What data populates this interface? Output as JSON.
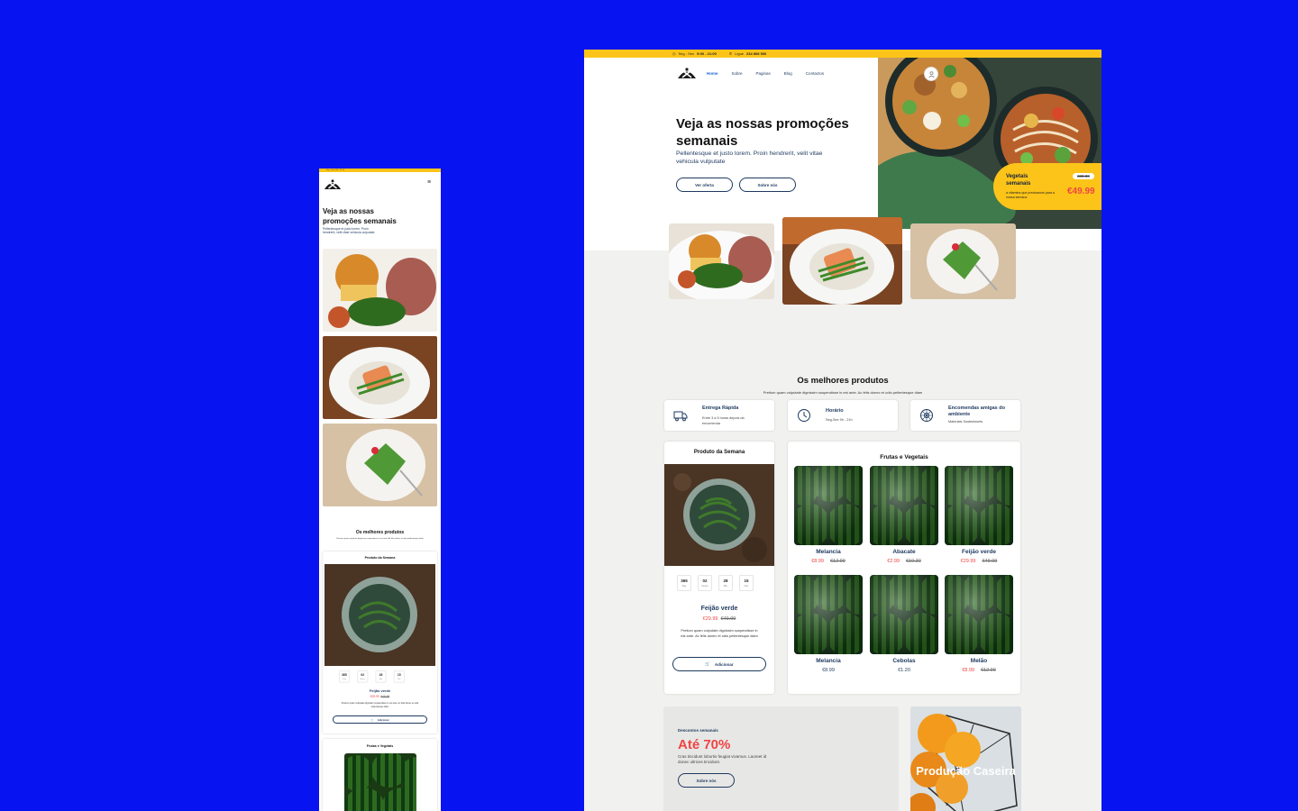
{
  "colors": {
    "background": "#0713f0",
    "accent_yellow": "#fcc419",
    "price_red": "#ef4444",
    "navy": "#1e3a5f"
  },
  "topbar": {
    "hours_label": "Seg - Sex",
    "hours_value": "9:00 - 21:00",
    "phone_label": "Ligue",
    "phone_value": "234 808 500"
  },
  "mobile_topbar": {
    "text": "Seg - Sex  9:00 - 21:00"
  },
  "nav": {
    "items": [
      {
        "label": "Home"
      },
      {
        "label": "Sobre"
      },
      {
        "label": "Paginas"
      },
      {
        "label": "Blog"
      },
      {
        "label": "Contactos"
      }
    ]
  },
  "hero": {
    "title": "Veja as nossas promoções semanais",
    "subtitle": "Pellentesque et justo lorem. Proin hendrerit, velit vitae vehicula vulputate",
    "primary_button": "Ver oferta",
    "secondary_button": "Sobre nós"
  },
  "promo": {
    "title": "Vegetais semanais",
    "description": "a vitamina que precisamos para a nossa semana",
    "old_price": "€80.00",
    "new_price": "€49.99"
  },
  "section": {
    "title": "Os melhores produtos",
    "subtitle": "Pretium quam vulputate dignissim suspendisse in est ante. Ac felis donec et odio pellentesque diam"
  },
  "features": [
    {
      "title": "Entrega Rápida",
      "desc": "Entre 3 a 5 horas depois da encomenda",
      "icon": "truck-icon"
    },
    {
      "title": "Horário",
      "desc": "Seg-Sex 9h - 21h",
      "icon": "clock-icon"
    },
    {
      "title": "Encomendas amigas do ambiente",
      "desc": "Materiais Sustentaveis",
      "icon": "eco-icon"
    }
  ],
  "week_product": {
    "heading": "Produto da Semana",
    "countdown": [
      {
        "value": "365",
        "unit": "Day"
      },
      {
        "value": "02",
        "unit": "Hours"
      },
      {
        "value": "28",
        "unit": "Min"
      },
      {
        "value": "15",
        "unit": "Sec"
      }
    ],
    "name": "Feijão verde",
    "new_price": "€29.99",
    "old_price": "€49.99",
    "desc": "Pretium quam vulputate dignissim suspendisse in est ante. Ac felis donec et odio pellentesque diam",
    "button": "Adicionar"
  },
  "fruits": {
    "heading": "Frutas e Vegetais",
    "items": [
      {
        "name": "Melancia",
        "new_price": "€8.99",
        "old_price": "€12.99"
      },
      {
        "name": "Abacate",
        "new_price": "€2.99",
        "old_price": "€10.30"
      },
      {
        "name": "Feijão verde",
        "new_price": "€29.99",
        "old_price": "€49.99"
      },
      {
        "name": "Melancia",
        "price": "€8.99"
      },
      {
        "name": "Cebolas",
        "price": "€1.20"
      },
      {
        "name": "Melão",
        "new_price": "€8.99",
        "old_price": "€12.99"
      }
    ]
  },
  "discounts": {
    "label": "Descontos semanais",
    "headline": "Até 70%",
    "text": "Cras tincidunt lobortis feugiat vivamus. Laoreet id donec ultrices tincidunt.",
    "button": "Sobre nós"
  },
  "homemade": {
    "title": "Produção Caseira"
  }
}
